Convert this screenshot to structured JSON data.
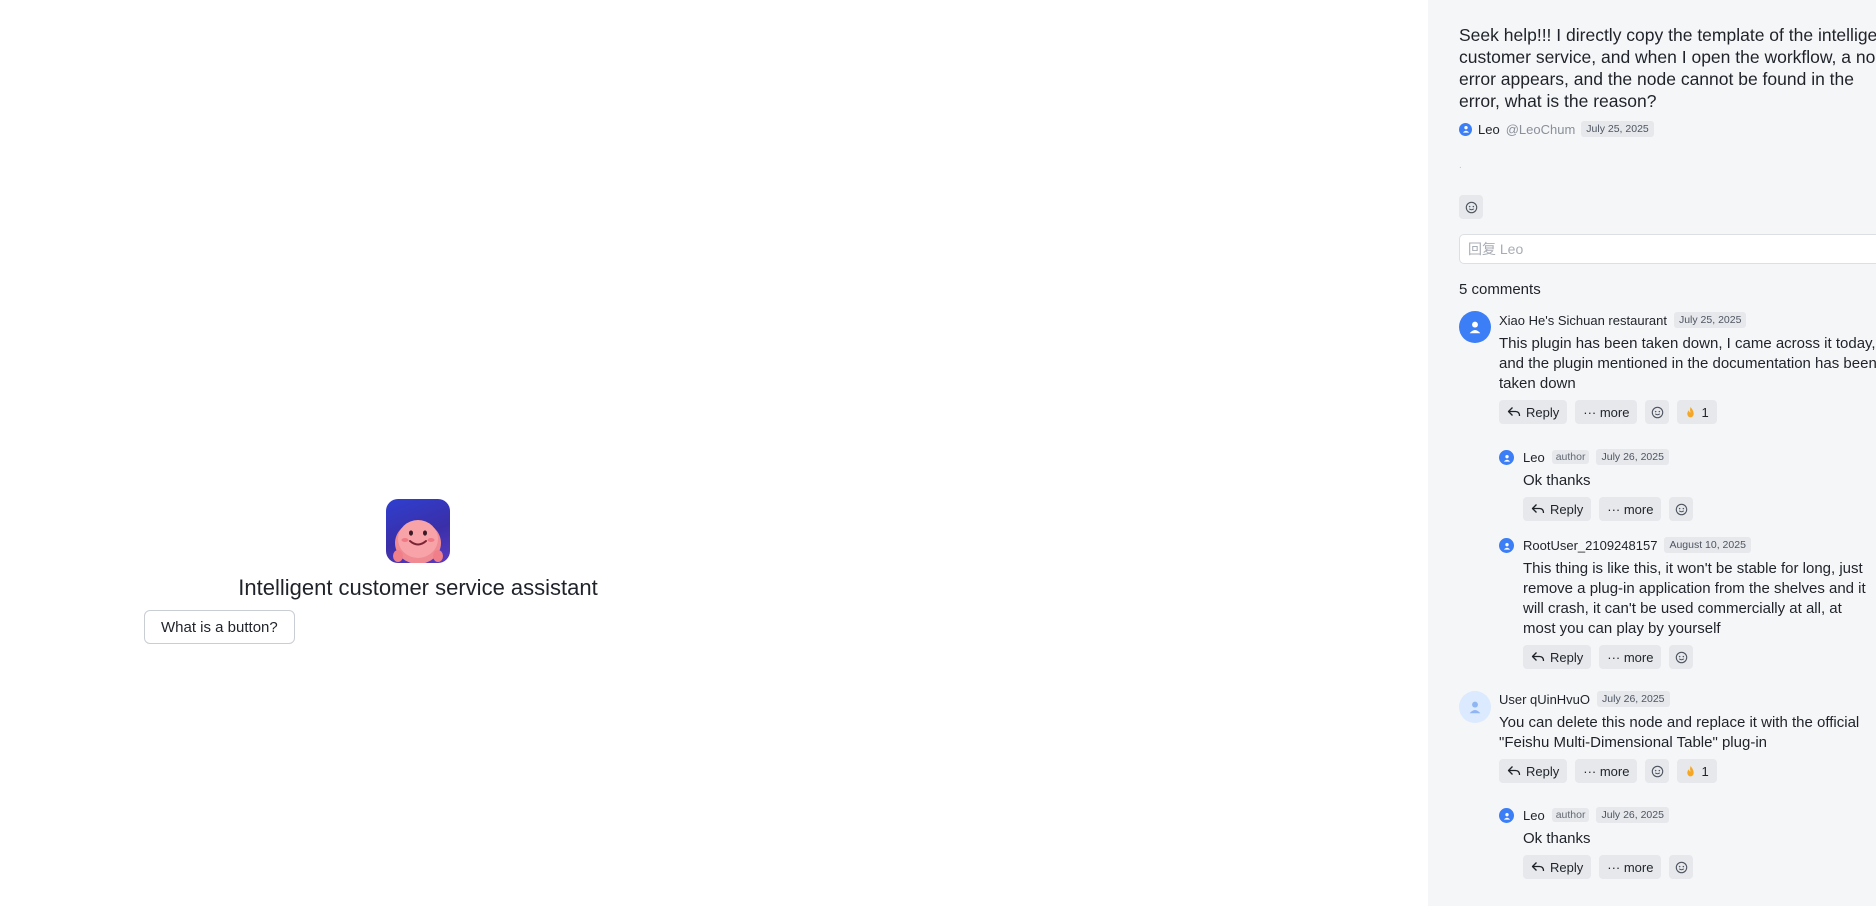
{
  "chat": {
    "bot_name": "Intelligent customer service assistant",
    "suggestion": "What is a button?"
  },
  "post": {
    "title_lines": [
      "Seek help!!! I directly copy the template of the intelligent",
      "customer service, and when I open the workflow, a node",
      "error appears, and the node cannot be found in the",
      "error, what is the reason?"
    ],
    "author": "Leo",
    "handle": "@LeoChum",
    "date": "July 25, 2025",
    "body": ".",
    "reply_placeholder": "回复 Leo"
  },
  "comments_count": "5 comments",
  "labels": {
    "reply": "Reply",
    "more": "··· more",
    "author_tag": "author"
  },
  "comments": [
    {
      "name": "Xiao He's Sichuan restaurant",
      "date": "July 25, 2025",
      "lines": [
        "This plugin has been taken down, I came across it today,",
        "and the plugin mentioned in the documentation has been",
        "taken down"
      ],
      "reaction": "1"
    },
    {
      "name": "Leo",
      "date": "July 26, 2025",
      "lines": [
        "Ok thanks"
      ]
    },
    {
      "name": "RootUser_2109248157",
      "date": "August 10, 2025",
      "lines": [
        "This thing is like this, it won't be stable for long, just",
        "remove a plug-in application from the shelves and it",
        "will crash, it can't be used commercially at all, at",
        "most you can play by yourself"
      ]
    },
    {
      "name": "User qUinHvuO",
      "date": "July 26, 2025",
      "lines": [
        "You can delete this node and replace it with the official",
        "\"Feishu Multi-Dimensional Table\" plug-in"
      ],
      "reaction": "1"
    },
    {
      "name": "Leo",
      "date": "July 26, 2025",
      "lines": [
        "Ok thanks"
      ]
    }
  ],
  "colors": {
    "panel_bg": "#f5f6f8",
    "avatar_blue": "#3b7ef6",
    "avatar_light": "#dbeafe"
  },
  "icons": [
    "user-icon",
    "smiley-icon",
    "reply-arrow-icon",
    "ellipsis-icon",
    "fire-icon"
  ]
}
